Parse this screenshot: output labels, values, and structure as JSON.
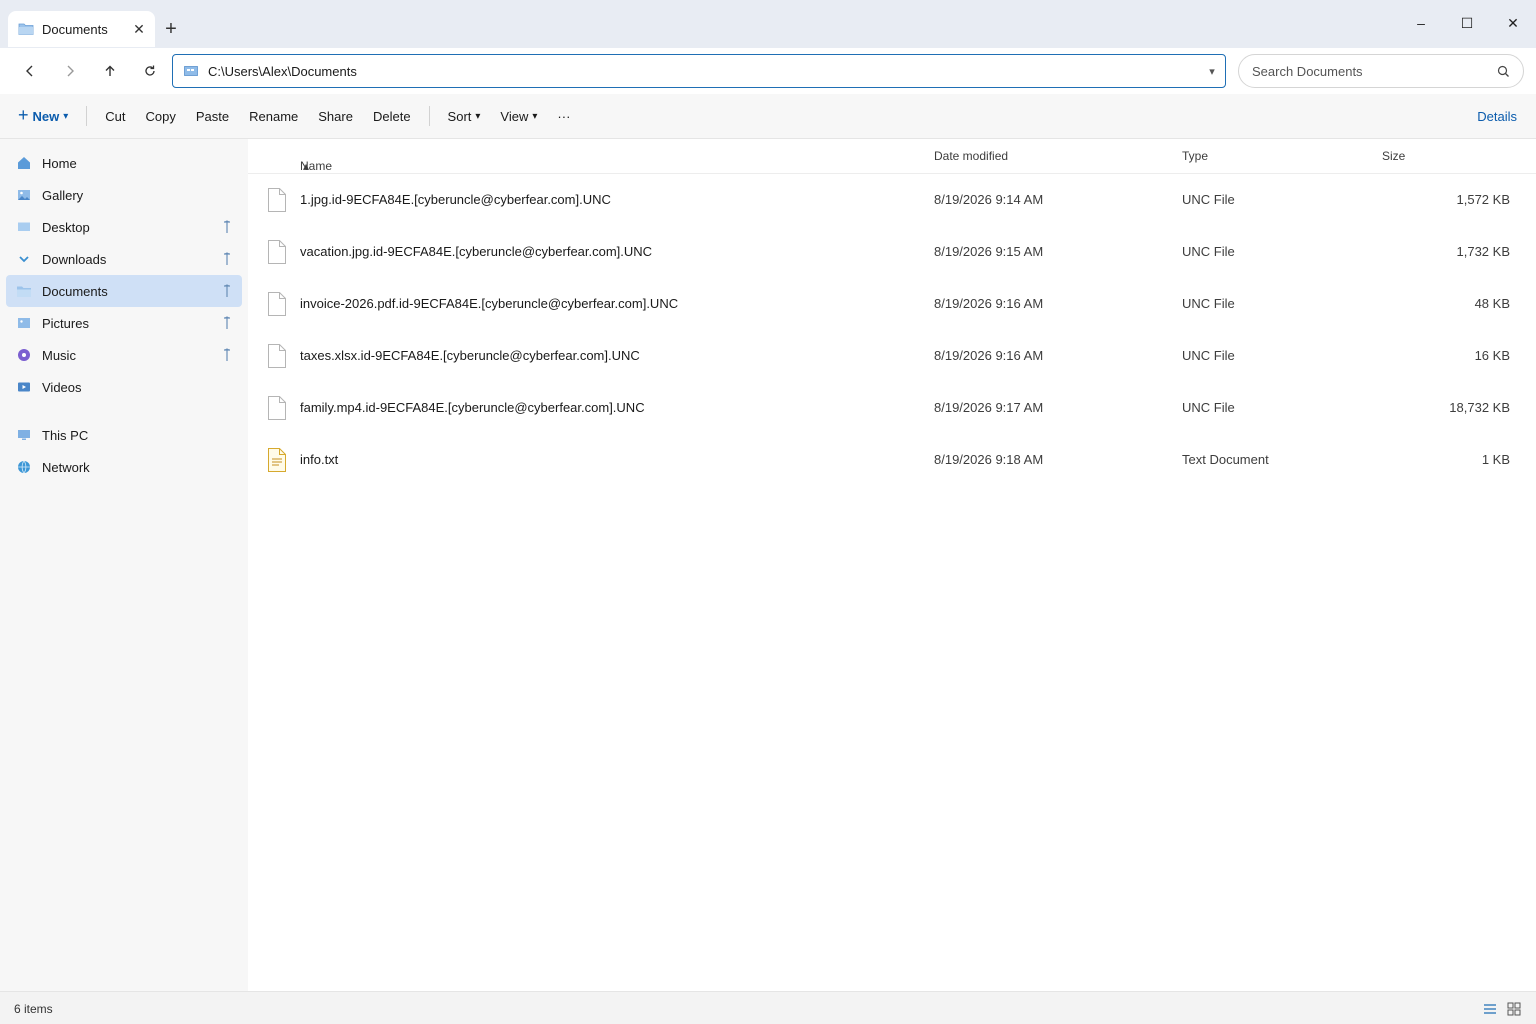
{
  "window": {
    "tab_title": "Documents",
    "tab_close": "✕",
    "new_tab": "+",
    "minimize": "–",
    "maximize": "☐",
    "close": "✕"
  },
  "address": {
    "path": "C:\\Users\\Alex\\Documents",
    "dropdown": "▾"
  },
  "search": {
    "placeholder": "Search Documents"
  },
  "toolbar": {
    "new_label": "New",
    "new_plus": "+",
    "caret": "▾",
    "cut": "Cut",
    "copy": "Copy",
    "paste": "Paste",
    "rename": "Rename",
    "share": "Share",
    "delete": "Delete",
    "sort": "Sort",
    "view": "View",
    "more": "···",
    "details": "Details"
  },
  "sidebar": {
    "items": [
      {
        "label": "Home",
        "icon": "home-icon",
        "pinned": false
      },
      {
        "label": "Gallery",
        "icon": "gallery-icon",
        "pinned": false
      },
      {
        "label": "Desktop",
        "icon": "desktop-icon",
        "pinned": true
      },
      {
        "label": "Downloads",
        "icon": "download-icon",
        "pinned": true
      },
      {
        "label": "Documents",
        "icon": "folder-icon",
        "pinned": true,
        "active": true
      },
      {
        "label": "Pictures",
        "icon": "pictures-icon",
        "pinned": true
      },
      {
        "label": "Music",
        "icon": "music-icon",
        "pinned": true
      },
      {
        "label": "Videos",
        "icon": "videos-icon",
        "pinned": false
      },
      {
        "label": "This PC",
        "icon": "pc-icon",
        "pinned": false
      },
      {
        "label": "Network",
        "icon": "network-icon",
        "pinned": false
      }
    ]
  },
  "columns": {
    "name": "Name",
    "name_sort": "▴",
    "date": "Date modified",
    "type": "Type",
    "size": "Size"
  },
  "files": [
    {
      "name": "1.jpg.id-9ECFA84E.[cyberuncle@cyberfear.com].UNC",
      "date": "8/19/2026 9:14 AM",
      "type": "UNC File",
      "size": "1,572 KB",
      "icon": "file-icon"
    },
    {
      "name": "vacation.jpg.id-9ECFA84E.[cyberuncle@cyberfear.com].UNC",
      "date": "8/19/2026 9:15 AM",
      "type": "UNC File",
      "size": "1,732 KB",
      "icon": "file-icon"
    },
    {
      "name": "invoice-2026.pdf.id-9ECFA84E.[cyberuncle@cyberfear.com].UNC",
      "date": "8/19/2026 9:16 AM",
      "type": "UNC File",
      "size": "48 KB",
      "icon": "file-icon"
    },
    {
      "name": "taxes.xlsx.id-9ECFA84E.[cyberuncle@cyberfear.com].UNC",
      "date": "8/19/2026 9:16 AM",
      "type": "UNC File",
      "size": "16 KB",
      "icon": "file-icon"
    },
    {
      "name": "family.mp4.id-9ECFA84E.[cyberuncle@cyberfear.com].UNC",
      "date": "8/19/2026 9:17 AM",
      "type": "UNC File",
      "size": "18,732 KB",
      "icon": "file-icon"
    },
    {
      "name": "info.txt",
      "date": "8/19/2026 9:18 AM",
      "type": "Text Document",
      "size": "1 KB",
      "icon": "text-document-icon"
    }
  ],
  "status": {
    "count": "6 items"
  },
  "colors": {
    "accent": "#0b5cad",
    "selection": "#cfe0f6",
    "titlebar": "#e8ecf3"
  }
}
